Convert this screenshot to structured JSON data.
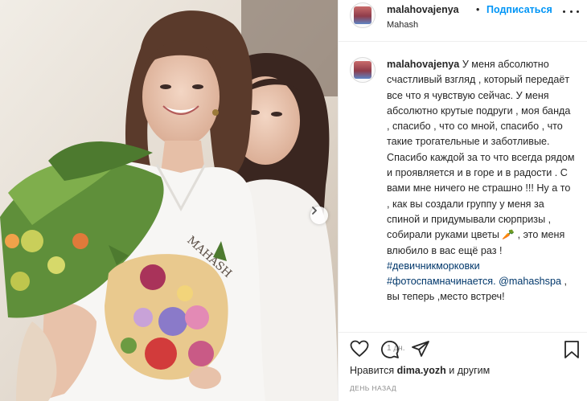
{
  "header": {
    "username": "malahovajenya",
    "separator": "•",
    "follow_label": "Подписаться",
    "location": "Mahash",
    "more_icon": "more-horizontal-icon"
  },
  "photo": {
    "robe_brand": "MAHASH",
    "next_icon": "chevron-right-icon"
  },
  "caption": {
    "username": "malahovajenya",
    "text_1": "У меня абсолютно счастливый взгляд , который передаёт все что я чувствую сейчас. У меня абсолютно крутые подруги , моя банда , спасибо , что со мной, спасибо , что такие трогательные и заботливые. Спасибо каждой за то что всегда рядом и проявляется и в горе и в радости . С вами мне ничего не страшно !!! Ну а то , как вы создали группу у меня за спиной и придумывали сюрпризы , собирали руками цветы ",
    "emoji": "🥕",
    "text_2": ", это меня влюбило в вас ещё раз !",
    "hashtag_1": "#девичникморковки",
    "hashtag_2": "#фотоспамначинается.",
    "mention": "@mahashspa",
    "text_3": ", вы теперь ,место встреч!",
    "time": "1 дн."
  },
  "actions": {
    "like_icon": "heart-icon",
    "comment_icon": "comment-icon",
    "share_icon": "share-icon",
    "save_icon": "bookmark-icon",
    "likes_prefix": "Нравится",
    "likes_user": "dima.yozh",
    "likes_suffix": "и другим",
    "ago": "ДЕНЬ НАЗАД"
  },
  "colors": {
    "follow": "#0095f6",
    "hashtag": "#00376b",
    "muted": "#8e8e8e"
  }
}
